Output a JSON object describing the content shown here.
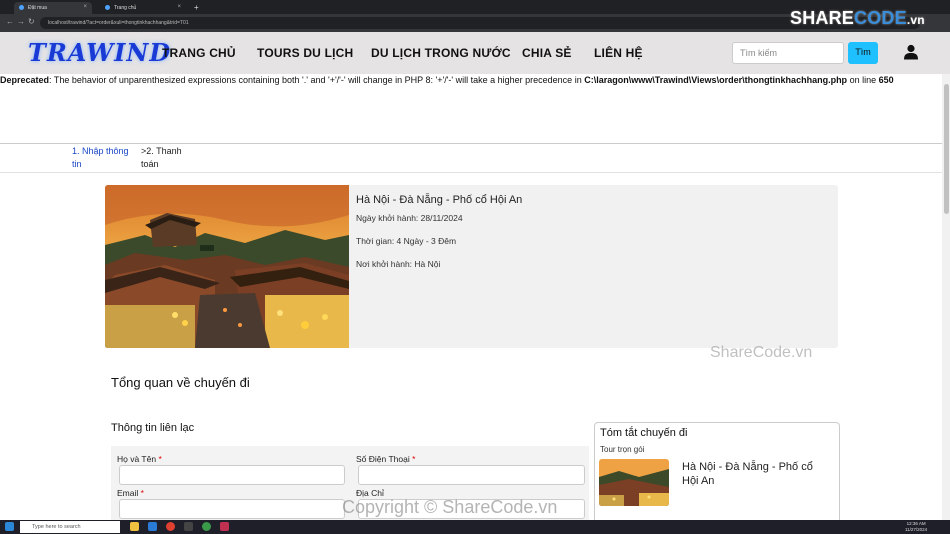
{
  "browser": {
    "tabs": [
      {
        "label": "Đặt mua",
        "active": true
      },
      {
        "label": "Trang chủ",
        "active": false
      }
    ],
    "new_tab": "+",
    "url": "localhost/trawind/?act=order&xuli=thongtinkhachhang&trid=T01"
  },
  "header": {
    "logo": "TRAWIND",
    "menu": [
      "TRANG CHỦ",
      "TOURS DU LỊCH",
      "DU LỊCH TRONG NƯỚC",
      "CHIA SẺ",
      "LIÊN HỆ"
    ],
    "search_placeholder": "Tìm kiếm",
    "search_button": "Tìm",
    "user_icon": "user-icon"
  },
  "warning": {
    "label": "Deprecated",
    "message": ": The behavior of unparenthesized expressions containing both '.' and '+'/'-' will change in PHP 8: '+'/'-' will take a higher precedence in ",
    "path": "C:\\laragon\\www\\Trawind\\Views\\order\\thongtinkhachhang.php",
    "on_line": " on line ",
    "line": "650"
  },
  "steps": {
    "step1": "1. Nhập thông tin",
    "step2": ">2. Thanh toán"
  },
  "tour": {
    "name": "Hà Nội - Đà Nẵng - Phố cổ Hội An",
    "start_date": "Ngày khởi hành: 28/11/2024",
    "duration": "Thời gian: 4 Ngày - 3 Đêm",
    "departure": "Nơi khởi hành: Hà Nội"
  },
  "overview": {
    "title": "Tổng quan về chuyến đi",
    "contact_title": "Thông tin liên lạc",
    "fields": {
      "fullname": "Họ và Tên",
      "phone": "Số Điện Thoại",
      "email": "Email",
      "address": "Địa Chỉ"
    },
    "required_mark": "*"
  },
  "summary": {
    "title": "Tóm tắt chuyến đi",
    "type": "Tour trọn gói",
    "name": "Hà Nội - Đà Nẵng - Phố cổ Hội An"
  },
  "watermarks": {
    "top_a": "SHARE",
    "top_b": "CODE",
    "top_c": ".vn",
    "middle": "ShareCode.vn",
    "bottom": "Copyright © ShareCode.vn"
  },
  "taskbar": {
    "search_placeholder": "Type here to search",
    "time": "12:36 AM",
    "date": "11/27/2024"
  },
  "colors": {
    "logo": "#1a3ad6",
    "search_button": "#1ec0ff",
    "step_active": "#1a47c4",
    "required": "#dd0000"
  }
}
